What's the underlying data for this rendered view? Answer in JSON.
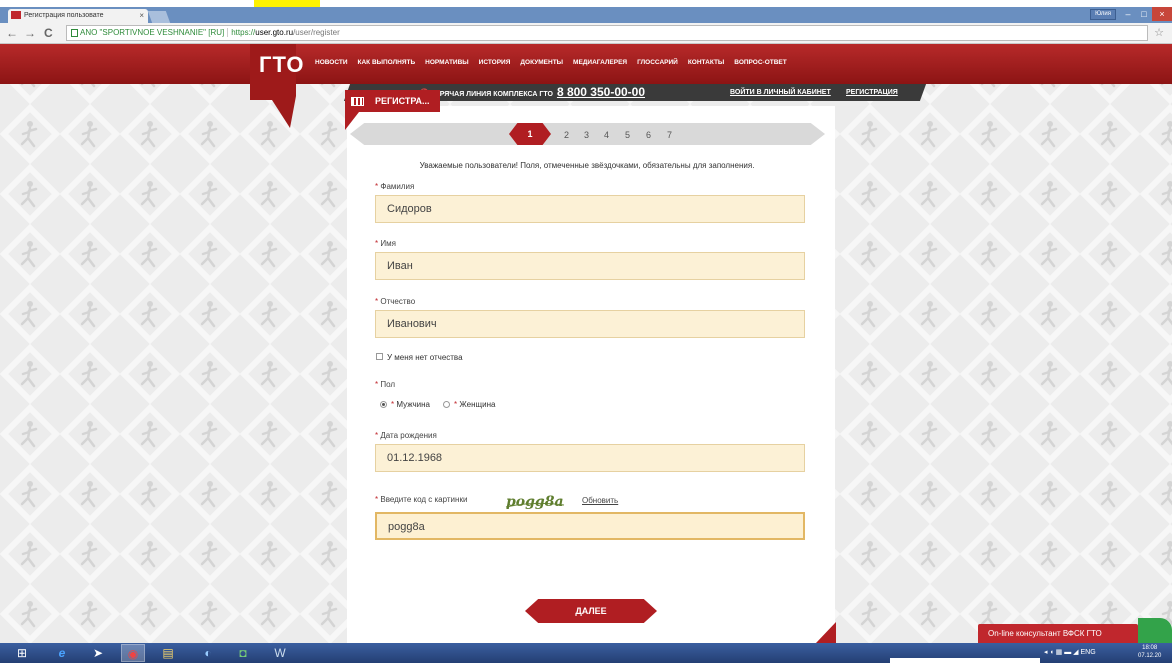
{
  "browser": {
    "tab_title": "Регистрация пользовате",
    "tab_close": "×",
    "user_badge": "Юлия",
    "win_min": "–",
    "win_max": "□",
    "win_close": "×",
    "back": "←",
    "forward": "→",
    "reload": "C",
    "url_org": "ANO \"SPORTIVNOE VESHNANIE\" [RU]",
    "url_scheme": "https://",
    "url_host": "user.gto.ru",
    "url_path": "/user/register",
    "star": "☆"
  },
  "header": {
    "logo": "ГТО",
    "nav": [
      "НОВОСТИ",
      "КАК ВЫПОЛНЯТЬ",
      "НОРМАТИВЫ",
      "ИСТОРИЯ",
      "ДОКУМЕНТЫ",
      "МЕДИАГАЛЕРЕЯ",
      "ГЛОССАРИЙ",
      "КОНТАКТЫ",
      "ВОПРОС-ОТВЕТ"
    ],
    "hotline_label": "ГОРЯЧАЯ ЛИНИЯ КОМПЛЕКСА ГТО",
    "hotline_phone": "8 800 350-00-00",
    "login_link": "ВОЙТИ В ЛИЧНЫЙ КАБИНЕТ",
    "register_link": "РЕГИСТРАЦИЯ",
    "page_tag": "РЕГИСТРА..."
  },
  "steps": {
    "active": "1",
    "others": [
      "2",
      "3",
      "4",
      "5",
      "6",
      "7"
    ]
  },
  "form": {
    "notice": "Уважаемые пользователи! Поля, отмеченные звёздочками, обязательны для заполнения.",
    "required_mark": "*",
    "surname_label": "Фамилия",
    "surname_value": "Сидоров",
    "name_label": "Имя",
    "name_value": "Иван",
    "patronymic_label": "Отчество",
    "patronymic_value": "Иванович",
    "no_patronymic_label": "У меня нет отчества",
    "gender_label": "Пол",
    "gender_male": "Мужчина",
    "gender_female": "Женщина",
    "gender_selected": "Мужчина",
    "birthdate_label": "Дата рождения",
    "birthdate_value": "01.12.1968",
    "captcha_label": "Введите код с картинки",
    "captcha_image_text": "pogg8a",
    "captcha_refresh": "Обновить",
    "captcha_value": "pogg8a",
    "next_button": "ДАЛЕЕ"
  },
  "consultant": {
    "label": "On-line консультант ВФСК ГТО"
  },
  "taskbar": {
    "tray_lang": "ENG",
    "time": "18:08",
    "date": "07.12.20"
  },
  "colors": {
    "brand_red": "#b01e22",
    "input_bg": "#fcf1d6",
    "header_dark": "#3a3a3a"
  }
}
